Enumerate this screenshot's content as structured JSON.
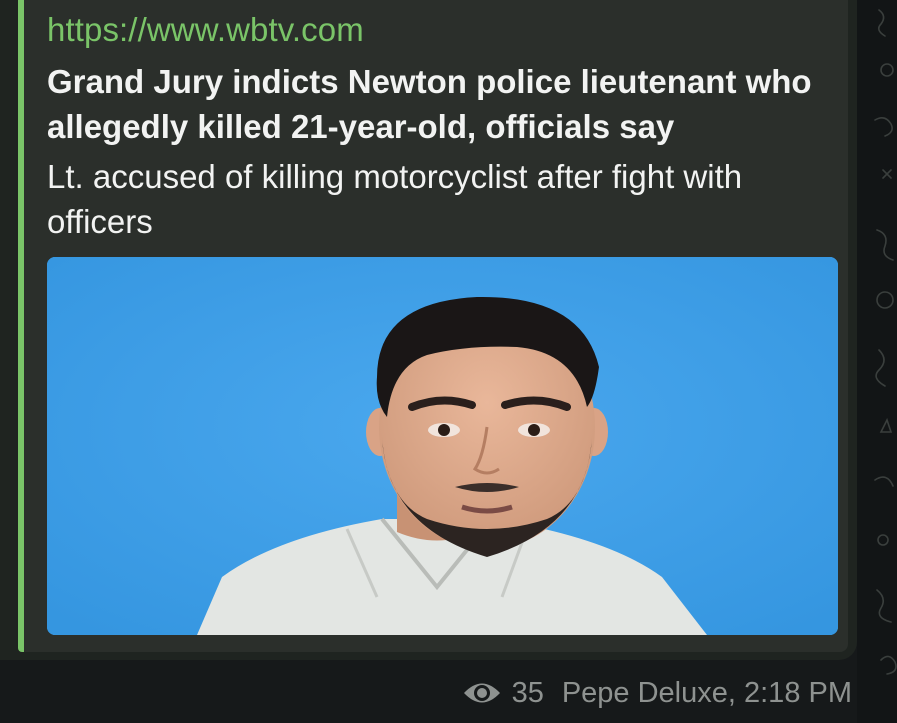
{
  "message": {
    "link_preview": {
      "site_url": "https://www.wbtv.com",
      "title": "Grand Jury indicts Newton police lieutenant who allegedly killed 21-year-old, officials say",
      "description": "Lt. accused of killing motorcyclist after fight with officers",
      "accent_color": "#7ac468",
      "image_background": "#3d9ee8"
    },
    "views_icon": "eye-icon",
    "views": "35",
    "sender_and_time": "Pepe Deluxe, 2:18 PM"
  }
}
